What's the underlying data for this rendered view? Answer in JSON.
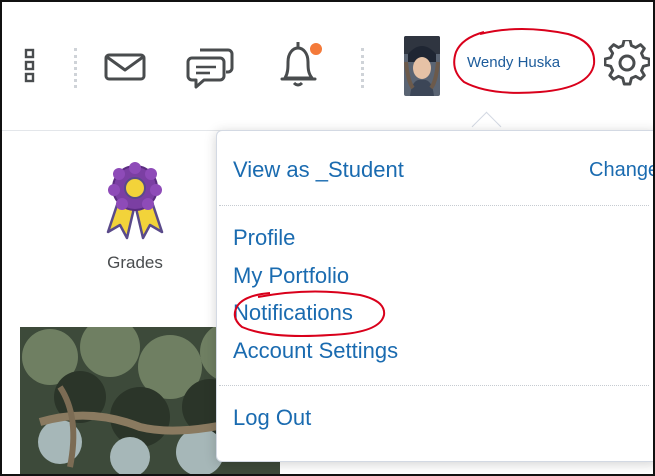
{
  "navbar": {
    "icons": {
      "apps": "waffle-icon",
      "email": "mail-icon",
      "chat": "chat-icon",
      "alerts": "bell-icon",
      "settings": "gear-icon"
    },
    "alert_badge_color": "#f47a3a",
    "user_name": "Wendy Huska",
    "annotation_color": "#d9001b"
  },
  "widgets": {
    "grades_label": "Grades"
  },
  "dropdown": {
    "view_as": "View as _Student",
    "change": "Change",
    "profile": "Profile",
    "portfolio": "My Portfolio",
    "notifications": "Notifications",
    "account_settings": "Account Settings",
    "logout": "Log Out",
    "link_color": "#1a6bb0"
  }
}
